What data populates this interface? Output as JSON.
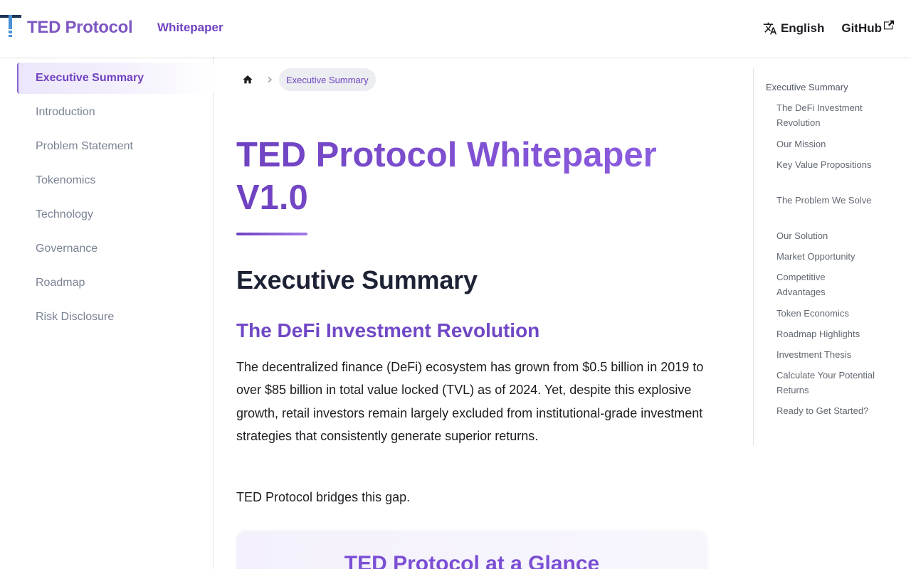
{
  "navbar": {
    "brand_title": "TED Protocol",
    "whitepaper_link": "Whitepaper",
    "language": "English",
    "github": "GitHub"
  },
  "colors": {
    "accent": "#6f42c1",
    "accent_light": "#9061e3",
    "sidebar_active_bg": "#ece6fb",
    "text_muted": "#7a8394"
  },
  "icons": {
    "logo": "ted-logo-icon",
    "language": "translate-icon",
    "github_external": "external-link-icon",
    "home": "home-icon",
    "breadcrumb_separator": "chevron-right-icon"
  },
  "sidebar": {
    "items": [
      {
        "label": "Executive Summary",
        "active": true
      },
      {
        "label": "Introduction",
        "active": false
      },
      {
        "label": "Problem Statement",
        "active": false
      },
      {
        "label": "Tokenomics",
        "active": false
      },
      {
        "label": "Technology",
        "active": false
      },
      {
        "label": "Governance",
        "active": false
      },
      {
        "label": "Roadmap",
        "active": false
      },
      {
        "label": "Risk Disclosure",
        "active": false
      }
    ]
  },
  "breadcrumb": {
    "current": "Executive Summary"
  },
  "main": {
    "title": "TED Protocol Whitepaper V1.0",
    "h2": "Executive Summary",
    "h3": "The DeFi Investment Revolution",
    "paragraph1": "The decentralized finance (DeFi) ecosystem has grown from $0.5 billion in 2019 to over $85 billion in total value locked (TVL) as of 2024. Yet, despite this explosive growth, retail investors remain largely excluded from institutional-grade investment strategies that consistently generate superior returns.",
    "paragraph2": "TED Protocol bridges this gap.",
    "glance_title": "TED Protocol at a Glance"
  },
  "toc": {
    "items": [
      "Executive Summary",
      "The DeFi Investment Revolution",
      "Our Mission",
      "Key Value Propositions",
      "The Problem We Solve",
      "Our Solution",
      "Market Opportunity",
      "Competitive Advantages",
      "Token Economics",
      "Roadmap Highlights",
      "Investment Thesis",
      "Calculate Your Potential Returns",
      "Ready to Get Started?"
    ]
  }
}
